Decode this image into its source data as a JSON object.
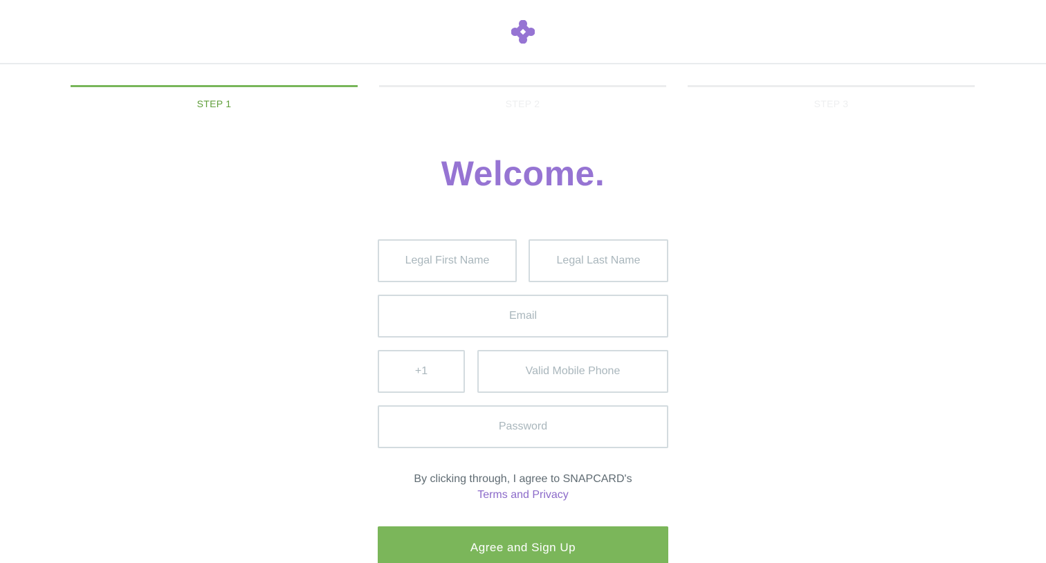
{
  "colors": {
    "brand_purple": "#9674d3",
    "accent_green": "#7bb65a",
    "input_border": "#d3dbdf",
    "placeholder": "#a9b6bc"
  },
  "header": {
    "logo_icon": "snapcard-diamond-logo"
  },
  "steps": [
    {
      "label": "STEP 1",
      "active": true
    },
    {
      "label": "STEP 2",
      "active": false
    },
    {
      "label": "STEP 3",
      "active": false
    }
  ],
  "main": {
    "title": "Welcome."
  },
  "form": {
    "first_name_placeholder": "Legal First Name",
    "last_name_placeholder": "Legal Last Name",
    "email_placeholder": "Email",
    "country_code_placeholder": "+1",
    "phone_placeholder": "Valid Mobile Phone",
    "password_placeholder": "Password",
    "terms_text": "By clicking through, I agree to SNAPCARD's",
    "terms_link": "Terms and Privacy",
    "submit_label": "Agree and Sign Up"
  }
}
